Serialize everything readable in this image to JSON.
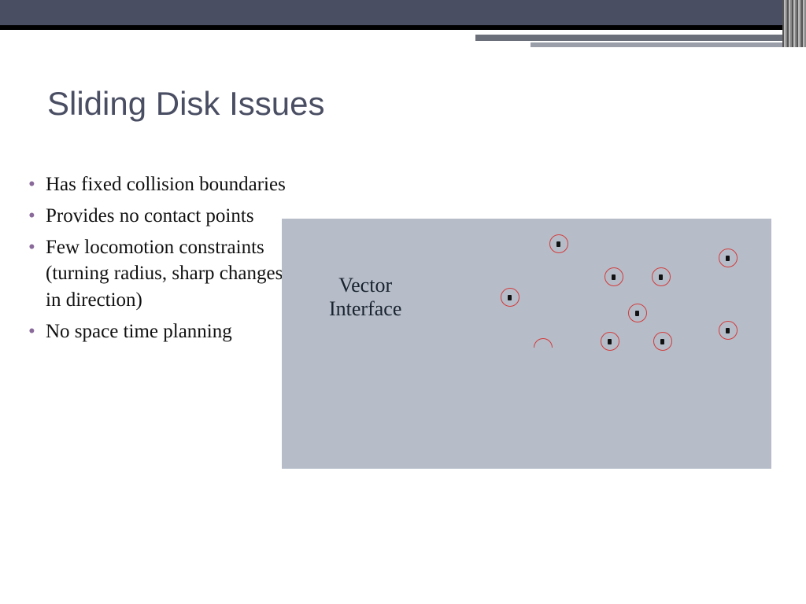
{
  "title": "Sliding Disk Issues",
  "bullets": [
    "Has fixed collision boundaries",
    "Provides no contact points",
    "Few locomotion constraints  (turning radius, sharp changes in direction)",
    "No space time planning"
  ],
  "diagram": {
    "label_line1": "Vector",
    "label_line2": "Interface"
  }
}
